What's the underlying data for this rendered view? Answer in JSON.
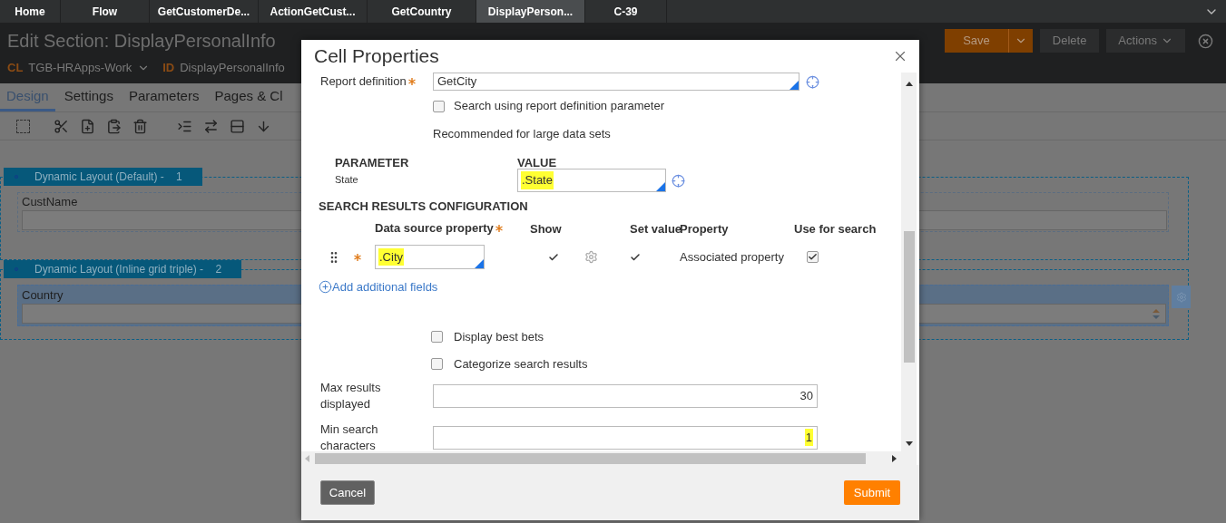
{
  "tabs": [
    {
      "label": "Home",
      "selected": false
    },
    {
      "label": "Flow",
      "selected": false
    },
    {
      "label": "GetCustomerDe...",
      "selected": false
    },
    {
      "label": "ActionGetCust...",
      "selected": false
    },
    {
      "label": "GetCountry",
      "selected": false
    },
    {
      "label": "DisplayPerson...",
      "selected": true
    },
    {
      "label": "C-39",
      "selected": false
    }
  ],
  "header": {
    "title": "Edit Section: DisplayPersonalInfo",
    "class_label": "CL",
    "class_value": "TGB-HRApps-Work",
    "id_label": "ID",
    "id_value": "DisplayPersonalInfo",
    "save": "Save",
    "delete": "Delete",
    "actions": "Actions"
  },
  "rule_tabs": [
    {
      "label": "Design",
      "selected": true
    },
    {
      "label": "Settings",
      "selected": false
    },
    {
      "label": "Parameters",
      "selected": false
    },
    {
      "label": "Pages & Cl",
      "selected": false
    }
  ],
  "layouts": [
    {
      "title": "Dynamic Layout (Default) -",
      "number": "1",
      "field_label": "CustName",
      "kind": "text",
      "selected": false
    },
    {
      "title": "Dynamic Layout (Inline grid triple) -",
      "number": "2",
      "field_label": "Country",
      "kind": "dropdown",
      "selected": true
    }
  ],
  "dialog": {
    "title": "Cell Properties",
    "report_definition": {
      "label": "Report definition",
      "value": "GetCity"
    },
    "search_param": {
      "label": "Search using report definition parameter",
      "checked": false
    },
    "note": "Recommended for large data sets",
    "parameters": {
      "columns": [
        "PARAMETER",
        "VALUE"
      ],
      "rows": [
        {
          "name": "State",
          "value": ".State",
          "highlighted": true
        }
      ]
    },
    "results_config": {
      "title": "SEARCH RESULTS CONFIGURATION",
      "columns": [
        "Data source property",
        "Show",
        "Set value",
        "Property",
        "Use for search"
      ],
      "rows": [
        {
          "source": ".City",
          "highlighted": true,
          "show": true,
          "set_value": true,
          "property": "Associated property",
          "use_for_search": true
        }
      ]
    },
    "add_link": "Add additional fields",
    "options": [
      {
        "label": "Display best bets",
        "checked": false
      },
      {
        "label": "Categorize search results",
        "checked": false
      }
    ],
    "fields": [
      {
        "label": "Max results displayed",
        "value": "30",
        "highlighted": false
      },
      {
        "label": "Min search characters",
        "value": "1",
        "highlighted": true
      }
    ],
    "cancel": "Cancel",
    "submit": "Submit"
  }
}
